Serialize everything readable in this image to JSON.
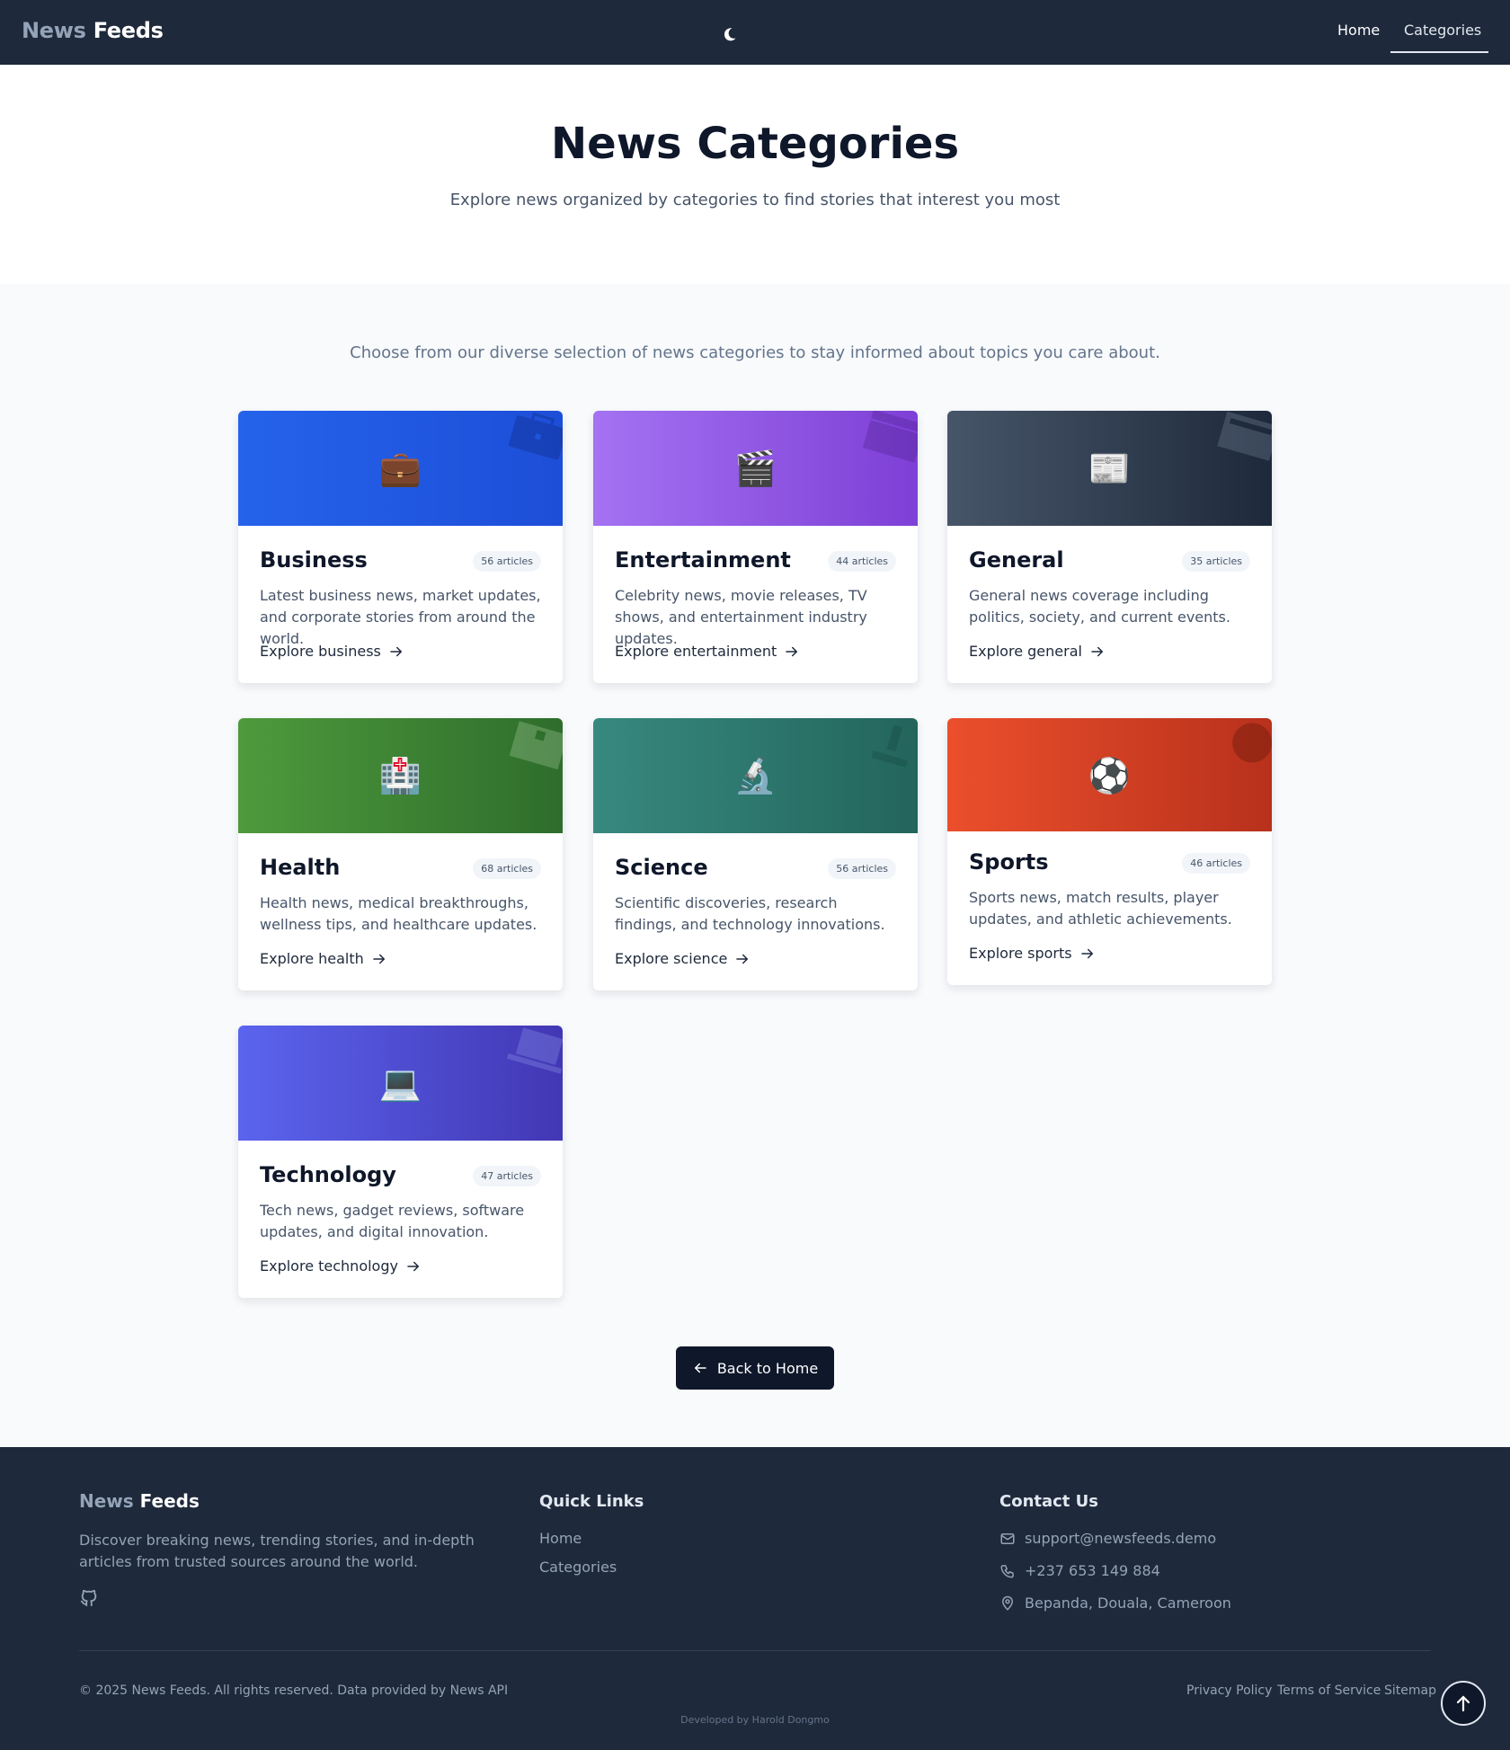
{
  "nav": {
    "logo_part1": "News",
    "logo_part2": "Feeds",
    "theme_icon": "moon-icon",
    "links": [
      {
        "label": "Home"
      },
      {
        "label": "Categories"
      }
    ]
  },
  "hero": {
    "title": "News Categories",
    "subtitle": "Explore news organized by categories to find stories that interest you most"
  },
  "intro": "Choose from our diverse selection of news categories to stay informed about topics you care about.",
  "categories": [
    {
      "name": "Business",
      "count": "56 articles",
      "emoji": "💼",
      "icon": "briefcase-icon",
      "accent": "#2563eb",
      "description": "Latest business news, market updates, and corporate stories from around the world.",
      "link": "Explore business"
    },
    {
      "name": "Entertainment",
      "count": "44 articles",
      "emoji": "🎬",
      "icon": "clapperboard-icon",
      "accent": "#a472f2",
      "description": "Celebrity news, movie releases, TV shows, and entertainment industry updates.",
      "link": "Explore entertainment"
    },
    {
      "name": "General",
      "count": "35 articles",
      "emoji": "📰",
      "icon": "newspaper-icon",
      "accent": "#475569",
      "description": "General news coverage including politics, society, and current events.",
      "link": "Explore general"
    },
    {
      "name": "Health",
      "count": "68 articles",
      "emoji": "🏥",
      "icon": "hospital-icon",
      "accent": "#4e9a3c",
      "description": "Health news, medical breakthroughs, wellness tips, and healthcare updates.",
      "link": "Explore health"
    },
    {
      "name": "Science",
      "count": "56 articles",
      "emoji": "🔬",
      "icon": "microscope-icon",
      "accent": "#37897f",
      "description": "Scientific discoveries, research findings, and technology innovations.",
      "link": "Explore science"
    },
    {
      "name": "Sports",
      "count": "46 articles",
      "emoji": "⚽",
      "icon": "soccer-ball-icon",
      "accent": "#eb4f2c",
      "description": "Sports news, match results, player updates, and athletic achievements.",
      "link": "Explore sports"
    },
    {
      "name": "Technology",
      "count": "47 articles",
      "emoji": "💻",
      "icon": "laptop-icon",
      "accent": "#5b64ee",
      "description": "Tech news, gadget reviews, software updates, and digital innovation.",
      "link": "Explore technology"
    }
  ],
  "back_button": "Back to Home",
  "footer": {
    "logo_part1": "News",
    "logo_part2": "Feeds",
    "description": "Discover breaking news, trending stories, and in-depth articles from trusted sources around the world.",
    "quick_links_heading": "Quick Links",
    "quick_links": [
      "Home",
      "Categories"
    ],
    "contact_heading": "Contact Us",
    "email": "support@newsfeeds.demo",
    "phone": "+237 653 149 884",
    "address": "Bepanda, Douala, Cameroon",
    "copyright": "© 2025 News Feeds. All rights reserved. Data provided by News API",
    "legal_links": [
      "Privacy Policy",
      "Terms of Service",
      "Sitemap"
    ],
    "developer": "Developed by Harold Dongmo"
  }
}
